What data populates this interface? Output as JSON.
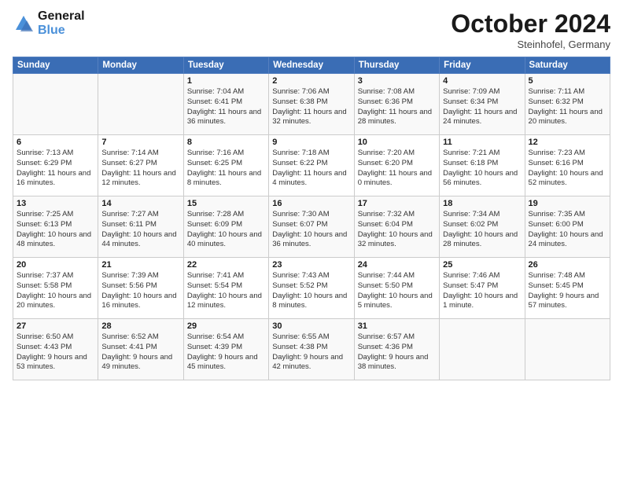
{
  "logo": {
    "line1": "General",
    "line2": "Blue"
  },
  "title": "October 2024",
  "location": "Steinhofel, Germany",
  "weekdays": [
    "Sunday",
    "Monday",
    "Tuesday",
    "Wednesday",
    "Thursday",
    "Friday",
    "Saturday"
  ],
  "weeks": [
    [
      {
        "day": "",
        "sunrise": "",
        "sunset": "",
        "daylight": ""
      },
      {
        "day": "",
        "sunrise": "",
        "sunset": "",
        "daylight": ""
      },
      {
        "day": "1",
        "sunrise": "Sunrise: 7:04 AM",
        "sunset": "Sunset: 6:41 PM",
        "daylight": "Daylight: 11 hours and 36 minutes."
      },
      {
        "day": "2",
        "sunrise": "Sunrise: 7:06 AM",
        "sunset": "Sunset: 6:38 PM",
        "daylight": "Daylight: 11 hours and 32 minutes."
      },
      {
        "day": "3",
        "sunrise": "Sunrise: 7:08 AM",
        "sunset": "Sunset: 6:36 PM",
        "daylight": "Daylight: 11 hours and 28 minutes."
      },
      {
        "day": "4",
        "sunrise": "Sunrise: 7:09 AM",
        "sunset": "Sunset: 6:34 PM",
        "daylight": "Daylight: 11 hours and 24 minutes."
      },
      {
        "day": "5",
        "sunrise": "Sunrise: 7:11 AM",
        "sunset": "Sunset: 6:32 PM",
        "daylight": "Daylight: 11 hours and 20 minutes."
      }
    ],
    [
      {
        "day": "6",
        "sunrise": "Sunrise: 7:13 AM",
        "sunset": "Sunset: 6:29 PM",
        "daylight": "Daylight: 11 hours and 16 minutes."
      },
      {
        "day": "7",
        "sunrise": "Sunrise: 7:14 AM",
        "sunset": "Sunset: 6:27 PM",
        "daylight": "Daylight: 11 hours and 12 minutes."
      },
      {
        "day": "8",
        "sunrise": "Sunrise: 7:16 AM",
        "sunset": "Sunset: 6:25 PM",
        "daylight": "Daylight: 11 hours and 8 minutes."
      },
      {
        "day": "9",
        "sunrise": "Sunrise: 7:18 AM",
        "sunset": "Sunset: 6:22 PM",
        "daylight": "Daylight: 11 hours and 4 minutes."
      },
      {
        "day": "10",
        "sunrise": "Sunrise: 7:20 AM",
        "sunset": "Sunset: 6:20 PM",
        "daylight": "Daylight: 11 hours and 0 minutes."
      },
      {
        "day": "11",
        "sunrise": "Sunrise: 7:21 AM",
        "sunset": "Sunset: 6:18 PM",
        "daylight": "Daylight: 10 hours and 56 minutes."
      },
      {
        "day": "12",
        "sunrise": "Sunrise: 7:23 AM",
        "sunset": "Sunset: 6:16 PM",
        "daylight": "Daylight: 10 hours and 52 minutes."
      }
    ],
    [
      {
        "day": "13",
        "sunrise": "Sunrise: 7:25 AM",
        "sunset": "Sunset: 6:13 PM",
        "daylight": "Daylight: 10 hours and 48 minutes."
      },
      {
        "day": "14",
        "sunrise": "Sunrise: 7:27 AM",
        "sunset": "Sunset: 6:11 PM",
        "daylight": "Daylight: 10 hours and 44 minutes."
      },
      {
        "day": "15",
        "sunrise": "Sunrise: 7:28 AM",
        "sunset": "Sunset: 6:09 PM",
        "daylight": "Daylight: 10 hours and 40 minutes."
      },
      {
        "day": "16",
        "sunrise": "Sunrise: 7:30 AM",
        "sunset": "Sunset: 6:07 PM",
        "daylight": "Daylight: 10 hours and 36 minutes."
      },
      {
        "day": "17",
        "sunrise": "Sunrise: 7:32 AM",
        "sunset": "Sunset: 6:04 PM",
        "daylight": "Daylight: 10 hours and 32 minutes."
      },
      {
        "day": "18",
        "sunrise": "Sunrise: 7:34 AM",
        "sunset": "Sunset: 6:02 PM",
        "daylight": "Daylight: 10 hours and 28 minutes."
      },
      {
        "day": "19",
        "sunrise": "Sunrise: 7:35 AM",
        "sunset": "Sunset: 6:00 PM",
        "daylight": "Daylight: 10 hours and 24 minutes."
      }
    ],
    [
      {
        "day": "20",
        "sunrise": "Sunrise: 7:37 AM",
        "sunset": "Sunset: 5:58 PM",
        "daylight": "Daylight: 10 hours and 20 minutes."
      },
      {
        "day": "21",
        "sunrise": "Sunrise: 7:39 AM",
        "sunset": "Sunset: 5:56 PM",
        "daylight": "Daylight: 10 hours and 16 minutes."
      },
      {
        "day": "22",
        "sunrise": "Sunrise: 7:41 AM",
        "sunset": "Sunset: 5:54 PM",
        "daylight": "Daylight: 10 hours and 12 minutes."
      },
      {
        "day": "23",
        "sunrise": "Sunrise: 7:43 AM",
        "sunset": "Sunset: 5:52 PM",
        "daylight": "Daylight: 10 hours and 8 minutes."
      },
      {
        "day": "24",
        "sunrise": "Sunrise: 7:44 AM",
        "sunset": "Sunset: 5:50 PM",
        "daylight": "Daylight: 10 hours and 5 minutes."
      },
      {
        "day": "25",
        "sunrise": "Sunrise: 7:46 AM",
        "sunset": "Sunset: 5:47 PM",
        "daylight": "Daylight: 10 hours and 1 minute."
      },
      {
        "day": "26",
        "sunrise": "Sunrise: 7:48 AM",
        "sunset": "Sunset: 5:45 PM",
        "daylight": "Daylight: 9 hours and 57 minutes."
      }
    ],
    [
      {
        "day": "27",
        "sunrise": "Sunrise: 6:50 AM",
        "sunset": "Sunset: 4:43 PM",
        "daylight": "Daylight: 9 hours and 53 minutes."
      },
      {
        "day": "28",
        "sunrise": "Sunrise: 6:52 AM",
        "sunset": "Sunset: 4:41 PM",
        "daylight": "Daylight: 9 hours and 49 minutes."
      },
      {
        "day": "29",
        "sunrise": "Sunrise: 6:54 AM",
        "sunset": "Sunset: 4:39 PM",
        "daylight": "Daylight: 9 hours and 45 minutes."
      },
      {
        "day": "30",
        "sunrise": "Sunrise: 6:55 AM",
        "sunset": "Sunset: 4:38 PM",
        "daylight": "Daylight: 9 hours and 42 minutes."
      },
      {
        "day": "31",
        "sunrise": "Sunrise: 6:57 AM",
        "sunset": "Sunset: 4:36 PM",
        "daylight": "Daylight: 9 hours and 38 minutes."
      },
      {
        "day": "",
        "sunrise": "",
        "sunset": "",
        "daylight": ""
      },
      {
        "day": "",
        "sunrise": "",
        "sunset": "",
        "daylight": ""
      }
    ]
  ]
}
